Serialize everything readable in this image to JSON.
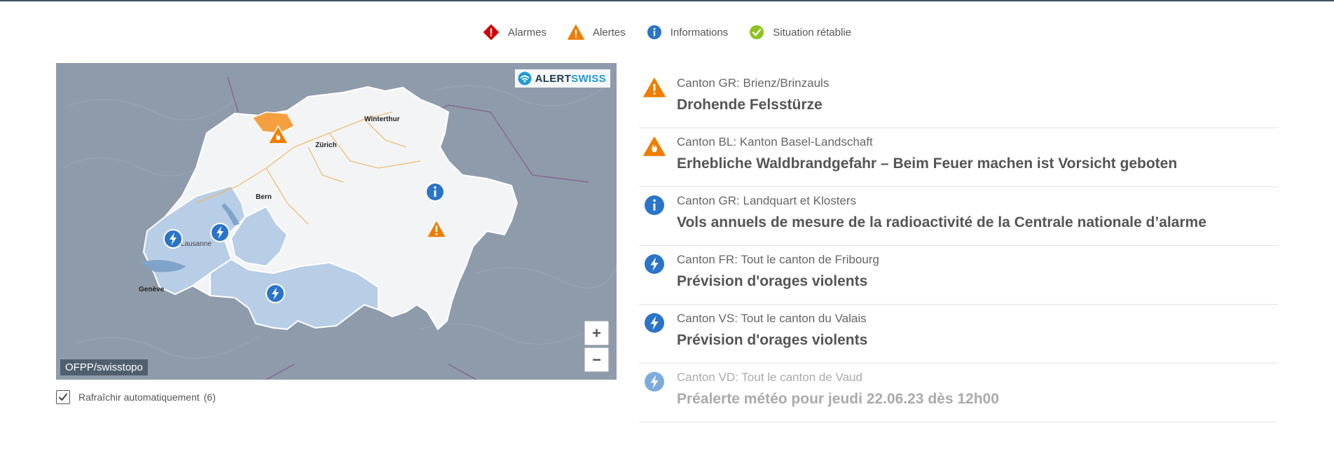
{
  "legend": [
    {
      "label": "Alarmes",
      "icon": "alarm-icon",
      "color": "#d40000"
    },
    {
      "label": "Alertes",
      "icon": "warning-icon",
      "color": "#f07d00"
    },
    {
      "label": "Informations",
      "icon": "info-icon",
      "color": "#2a74c9"
    },
    {
      "label": "Situation rétablie",
      "icon": "check-icon",
      "color": "#8ec21d"
    }
  ],
  "map": {
    "brand_part1": "ALERT",
    "brand_part2": "SWISS",
    "attribution": "OFPP/swisstopo",
    "zoom_in": "+",
    "zoom_out": "−",
    "cities": {
      "winterthur": "Winterthur",
      "zurich": "Zürich",
      "bern": "Bern",
      "lausanne": "Lausanne",
      "geneve": "Genève"
    }
  },
  "refresh": {
    "label": "Rafraîchir automatiquement",
    "count": "(6)",
    "checked": true
  },
  "events": [
    {
      "type": "warning",
      "icon": "warning-icon",
      "place": "Canton GR: Brienz/Brinzauls",
      "title": "Drohende Felsstürze",
      "faded": false
    },
    {
      "type": "fire-warning",
      "icon": "fire-warning-icon",
      "place": "Canton BL: Kanton Basel-Landschaft",
      "title": "Erhebliche Waldbrandgefahr – Beim Feuer machen ist Vorsicht geboten",
      "faded": false
    },
    {
      "type": "info",
      "icon": "info-icon",
      "place": "Canton GR: Landquart et Klosters",
      "title": "Vols annuels de mesure de la radioactivité de la Centrale nationale d’alarme",
      "faded": false
    },
    {
      "type": "storm",
      "icon": "lightning-icon",
      "place": "Canton FR: Tout le canton de Fribourg",
      "title": "Prévision d'orages violents",
      "faded": false
    },
    {
      "type": "storm",
      "icon": "lightning-icon",
      "place": "Canton VS: Tout le canton du Valais",
      "title": "Prévision d'orages violents",
      "faded": false
    },
    {
      "type": "storm",
      "icon": "lightning-icon",
      "place": "Canton VD: Tout le canton de Vaud",
      "title": "Préalerte météo pour jeudi 22.06.23 dès 12h00",
      "faded": true
    }
  ]
}
